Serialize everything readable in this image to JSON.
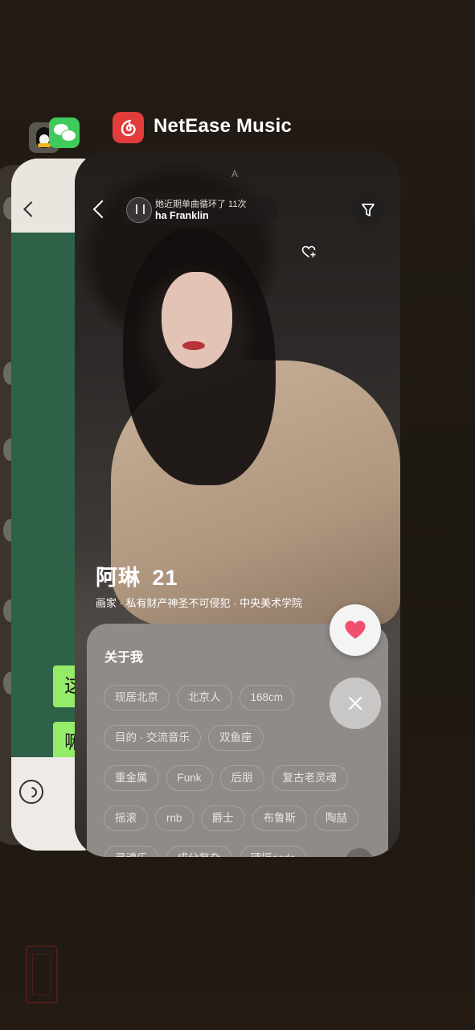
{
  "app_switcher": {
    "current_app": "NetEase Music",
    "background_apps": [
      "QQ",
      "WeChat"
    ]
  },
  "wechat_preview": {
    "bubbles": [
      "这",
      "嘛"
    ]
  },
  "now_playing": {
    "line1": "她近期单曲循环了 11次",
    "line2": "ha Franklin",
    "fade": "A"
  },
  "profile": {
    "name": "阿琳",
    "age": "21",
    "meta": "画家 · 私有财产神圣不可侵犯 · 中央美术学院"
  },
  "about": {
    "title": "关于我",
    "tags_row1": [
      "现居北京",
      "北京人",
      "168cm"
    ],
    "tags_row2": [
      "目的 · 交流音乐",
      "双鱼座"
    ],
    "tags_row3": [
      "重金属",
      "Funk",
      "后朋",
      "复古老灵魂"
    ],
    "tags_row4": [
      "摇滚",
      "rnb",
      "爵士",
      "布鲁斯",
      "陶喆"
    ],
    "tags_row5": [
      "灵魂乐",
      "成分复杂",
      "硬摇acdc"
    ]
  },
  "colors": {
    "netease_red": "#e23d3a",
    "wechat_green": "#3fcb5b",
    "like_heart": "#f0506e"
  }
}
